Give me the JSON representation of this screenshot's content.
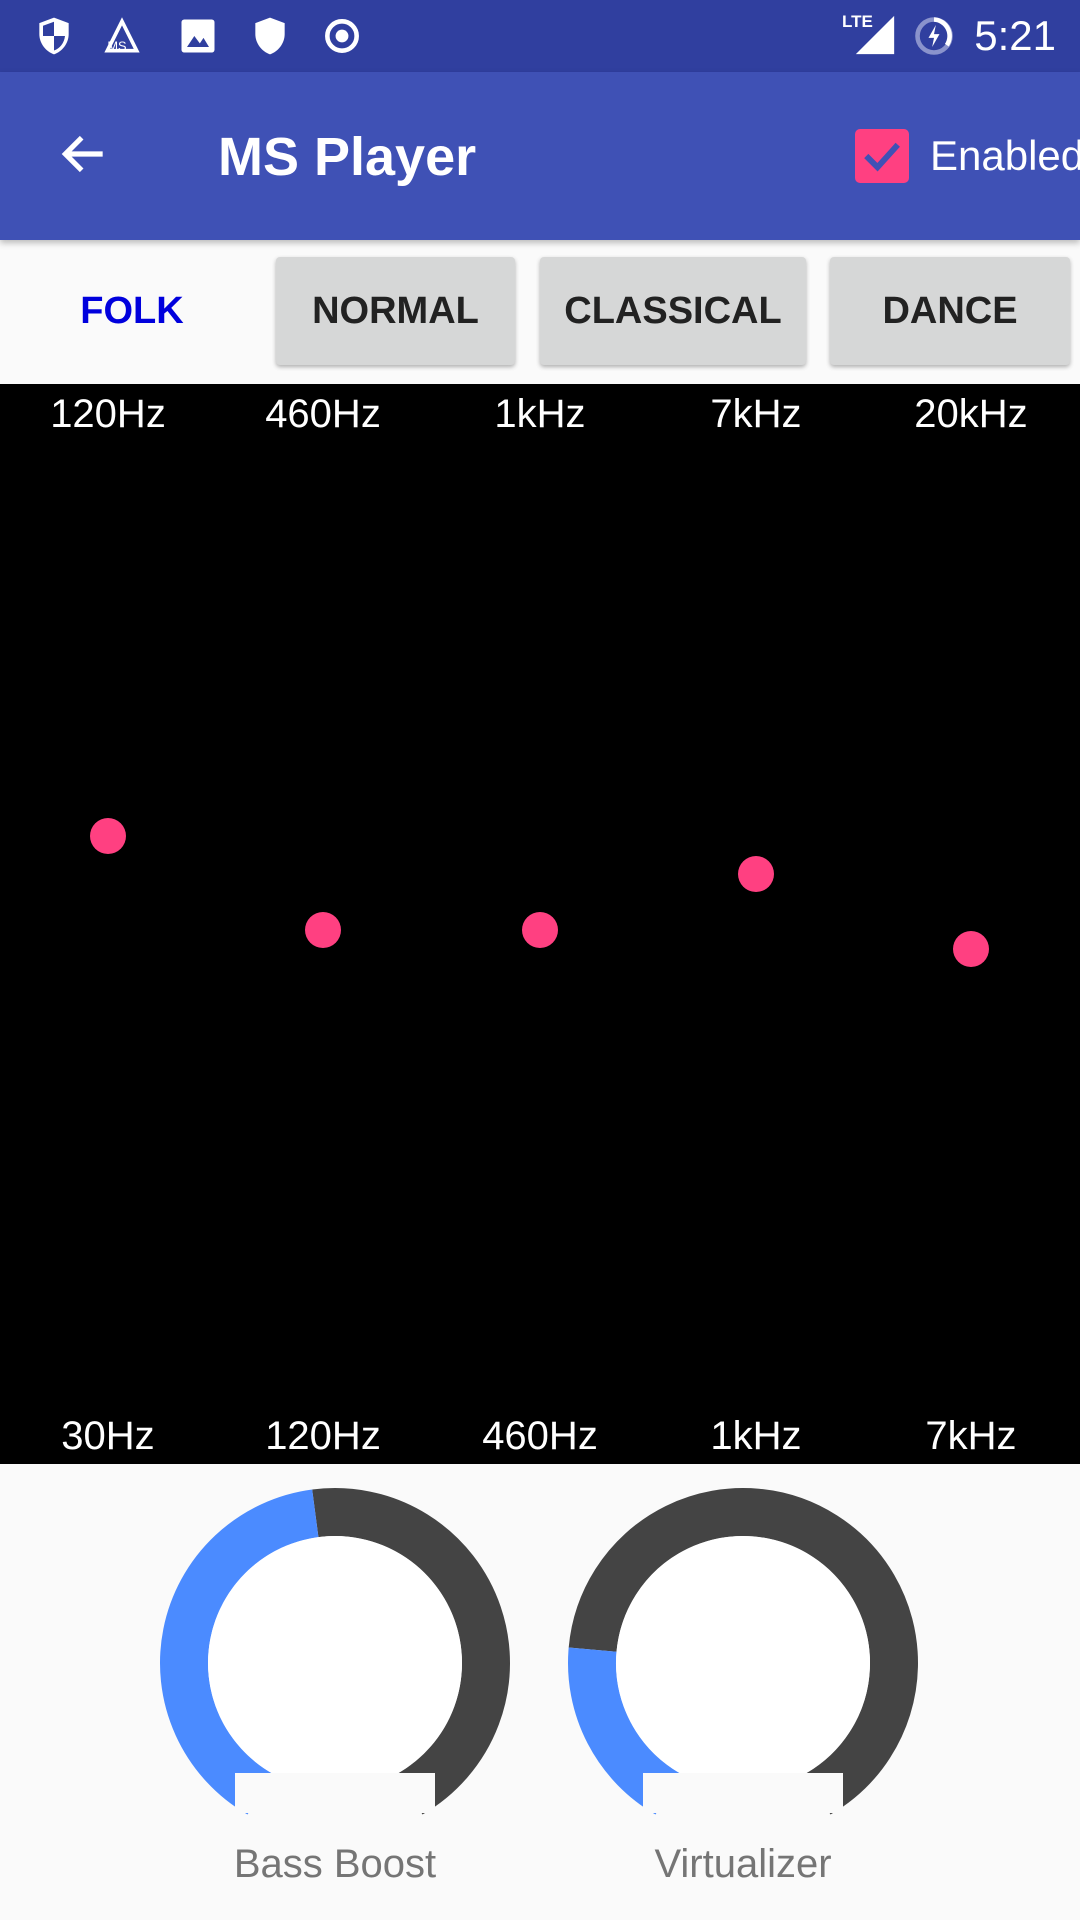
{
  "status_bar": {
    "time": "5:21",
    "network": "LTE",
    "icons": [
      "shield-half-icon",
      "ms-player-notification-icon",
      "image-icon",
      "shield-icon",
      "target-icon",
      "lte-signal-icon",
      "battery-charging-icon"
    ]
  },
  "app_bar": {
    "title": "MS Player",
    "back_icon": "arrow-left-icon",
    "enabled_label": "Enabled",
    "enabled_checked": true
  },
  "presets": [
    {
      "label": "FOLK",
      "selected": true
    },
    {
      "label": "NORMAL",
      "selected": false
    },
    {
      "label": "CLASSICAL",
      "selected": false
    },
    {
      "label": "DANCE",
      "selected": false
    }
  ],
  "equalizer": {
    "bands": [
      {
        "top_label": "120Hz",
        "bottom_label": "30Hz",
        "level": 0.6
      },
      {
        "top_label": "460Hz",
        "bottom_label": "120Hz",
        "level": 0.5
      },
      {
        "top_label": "1kHz",
        "bottom_label": "460Hz",
        "level": 0.5
      },
      {
        "top_label": "7kHz",
        "bottom_label": "1kHz",
        "level": 0.56
      },
      {
        "top_label": "20kHz",
        "bottom_label": "7kHz",
        "level": 0.48
      }
    ]
  },
  "knobs": [
    {
      "label": "Bass Boost",
      "value": 0.475
    },
    {
      "label": "Virtualizer",
      "value": 0.217
    }
  ],
  "colors": {
    "status_bar": "#303F9F",
    "app_bar": "#3F51B5",
    "accent": "#FF4081",
    "knob_fill": "#4B8BFF",
    "knob_track": "#444444",
    "selected_preset": "#0000DD"
  }
}
